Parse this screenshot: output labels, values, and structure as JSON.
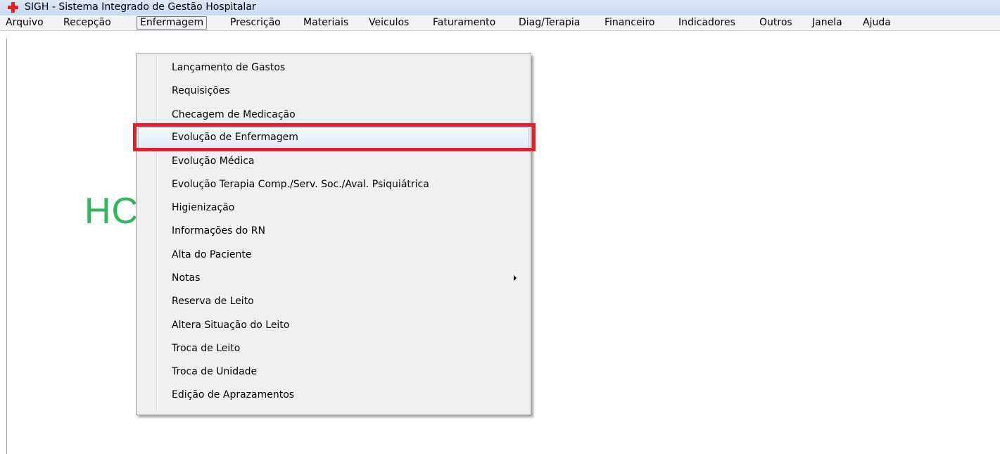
{
  "window": {
    "title": "SIGH - Sistema Integrado de Gestão Hospitalar",
    "icon": "red-cross-icon",
    "icon_color": "#e31f1f"
  },
  "menubar": {
    "items": [
      {
        "label": "Arquivo"
      },
      {
        "label": "Recepção"
      },
      {
        "label": "Enfermagem",
        "active": true
      },
      {
        "label": "Prescrição"
      },
      {
        "label": "Materiais"
      },
      {
        "label": "Veiculos"
      },
      {
        "label": "Faturamento"
      },
      {
        "label": "Diag/Terapia"
      },
      {
        "label": "Financeiro"
      },
      {
        "label": "Indicadores"
      },
      {
        "label": "Outros"
      },
      {
        "label": "Janela"
      },
      {
        "label": "Ajuda"
      }
    ]
  },
  "background": {
    "partial_title": "HC",
    "title_color": "#2db85a"
  },
  "dropdown": {
    "items": [
      {
        "label": "Lançamento de Gastos"
      },
      {
        "label": "Requisições"
      },
      {
        "label": "Checagem de Medicação"
      },
      {
        "label": "Evolução de Enfermagem",
        "highlighted": true
      },
      {
        "label": "Evolução Médica"
      },
      {
        "label": "Evolução Terapia Comp./Serv. Soc./Aval. Psiquiátrica"
      },
      {
        "label": "Higienização"
      },
      {
        "label": "Informações do RN"
      },
      {
        "label": "Alta do Paciente"
      },
      {
        "label": "Notas",
        "submenu": true
      },
      {
        "label": "Reserva de Leito"
      },
      {
        "label": "Altera Situação do Leito"
      },
      {
        "label": "Troca de Leito"
      },
      {
        "label": "Troca de Unidade"
      },
      {
        "label": "Edição de Aprazamentos"
      }
    ]
  },
  "annotation": {
    "color": "#e0202a"
  }
}
